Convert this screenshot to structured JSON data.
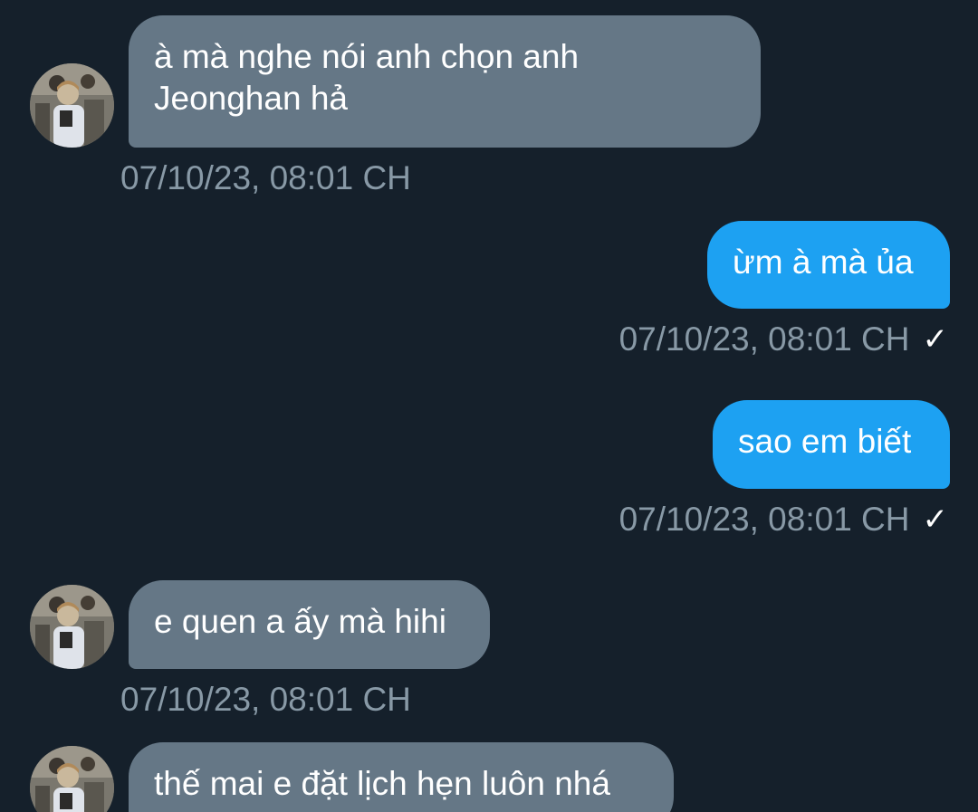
{
  "messages": [
    {
      "direction": "incoming",
      "text": "à mà nghe nói anh chọn anh\nJeonghan hả",
      "timestamp": "07/10/23, 08:01 CH"
    },
    {
      "direction": "outgoing",
      "text": "ừm à mà ủa",
      "timestamp": "07/10/23, 08:01 CH",
      "status_icon": "✓"
    },
    {
      "direction": "outgoing",
      "text": "sao em biết",
      "timestamp": "07/10/23, 08:01 CH",
      "status_icon": "✓"
    },
    {
      "direction": "incoming",
      "text": "e quen a ấy mà hihi",
      "timestamp": "07/10/23, 08:01 CH"
    },
    {
      "direction": "incoming",
      "text": "thế mai e đặt lịch hẹn luôn nhá",
      "timestamp": ""
    }
  ],
  "colors": {
    "background": "#15202b",
    "incoming_bubble": "#657786",
    "outgoing_bubble": "#1da1f2",
    "timestamp": "#8899a6"
  }
}
